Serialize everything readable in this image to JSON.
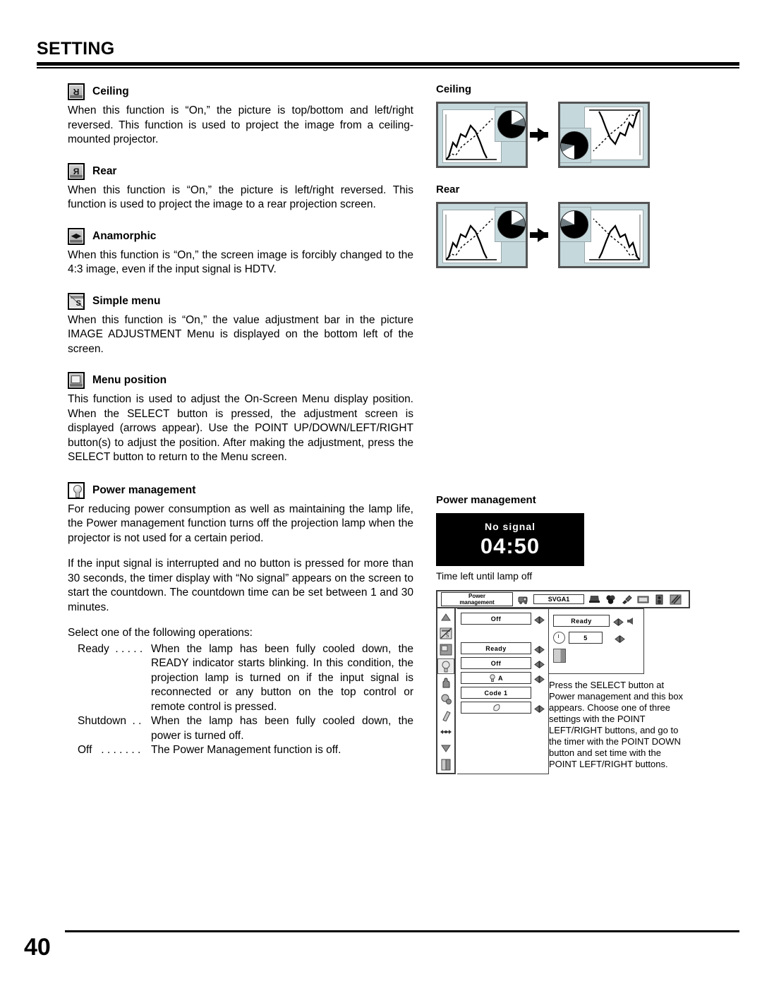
{
  "header": {
    "title": "SETTING"
  },
  "left_column": {
    "sections": [
      {
        "icon": "ceiling-icon",
        "icon_glyph": "R",
        "title": "Ceiling",
        "body": "When this function is “On,” the picture is top/bottom and left/right reversed. This function is used to project the image from a ceiling-mounted projector."
      },
      {
        "icon": "rear-icon",
        "icon_glyph": "R",
        "title": "Rear",
        "body": "When this function is “On,” the picture is left/right reversed. This function is used to project the image to a rear projection screen."
      },
      {
        "icon": "anamorphic-icon",
        "icon_glyph": "◀▶",
        "title": "Anamorphic",
        "body": "When this function is “On,” the screen image is forcibly changed to the 4:3 image, even if the input signal is HDTV."
      },
      {
        "icon": "simple-menu-icon",
        "icon_glyph": "S",
        "title": "Simple menu",
        "body": "When this function is “On,” the value adjustment bar in the picture IMAGE ADJUSTMENT Menu is displayed on the bottom left of the screen."
      },
      {
        "icon": "menu-position-icon",
        "icon_glyph": "☰",
        "title": "Menu position",
        "body": "This function is used to adjust the On-Screen Menu display position. When the SELECT button is pressed, the adjustment screen is displayed (arrows appear). Use the POINT UP/DOWN/LEFT/RIGHT button(s) to adjust the position. After making the adjustment, press the SELECT button to return to the Menu screen."
      },
      {
        "icon": "power-management-icon",
        "icon_glyph": "●",
        "title": "Power management",
        "body": "For reducing power consumption as well as maintaining the lamp life, the Power management function turns off the projection lamp when the projector is not used for a certain period.",
        "body2": "If the input signal is interrupted and no button is pressed for more than 30 seconds, the timer display with “No signal” appears on the screen to start the countdown. The countdown time can be set between 1 and 30 minutes.",
        "body3": "Select one of the following operations:"
      }
    ],
    "operations": [
      {
        "term": "Ready  . . . . .",
        "desc": "When the lamp has been fully cooled down, the READY indicator starts blinking. In this condition, the projection lamp is turned on if the input signal is reconnected or any button on the top control or remote control is pressed."
      },
      {
        "term": "Shutdown  . .",
        "desc": "When the lamp has been fully cooled down, the power is turned off."
      },
      {
        "term": "Off   . . . . . . .",
        "desc": "The Power Management function is off."
      }
    ]
  },
  "right_column": {
    "ceiling_illustration": {
      "label": "Ceiling",
      "transform": "rotate-180"
    },
    "rear_illustration": {
      "label": "Rear",
      "transform": "mirror-horizontal"
    },
    "power_management": {
      "label": "Power management",
      "no_signal_label": "No signal",
      "timer": "04:50",
      "timer_minutes": "04",
      "timer_seconds": "50",
      "caption": "Time left until lamp off"
    },
    "osd": {
      "menu_title_line1": "Power",
      "menu_title_line2": "management",
      "input_value": "SVGA1",
      "top_icons": [
        "projector-icon",
        "computer-icon",
        "color-adjust-icon",
        "image-adjust-icon",
        "screen-icon",
        "sound-icon",
        "setting-icon"
      ],
      "side_icons": [
        "scroll-up-icon",
        "simple-menu-icon",
        "menu-position-icon",
        "power-management-icon",
        "hand-icon",
        "balloon-icon",
        "eraser-icon",
        "usb-icon",
        "scroll-down-icon",
        "exit-icon"
      ],
      "selected_side_icon": "power-management-icon",
      "left_options": [
        {
          "label": "Off",
          "has_arrows": true
        },
        {
          "label": "",
          "has_arrows": false,
          "spacer": true
        },
        {
          "label": "Ready",
          "has_arrows": true
        },
        {
          "label": "Off",
          "has_arrows": true
        },
        {
          "label": "A",
          "has_arrows": true,
          "icon": "lamp-icon"
        },
        {
          "label": "Code 1",
          "has_arrows": false
        },
        {
          "label": "",
          "has_arrows": true,
          "icon": "mouse-icon"
        }
      ],
      "right_panel": {
        "setting_value": "Ready",
        "timer_value": "5",
        "exit_icon": "exit-icon"
      },
      "caption": "Press the SELECT button at Power management and this box appears. Choose one of three settings with the POINT LEFT/RIGHT buttons, and go to the timer with the POINT DOWN button and set time with the POINT LEFT/RIGHT buttons."
    }
  },
  "footer": {
    "page_number": "40"
  }
}
